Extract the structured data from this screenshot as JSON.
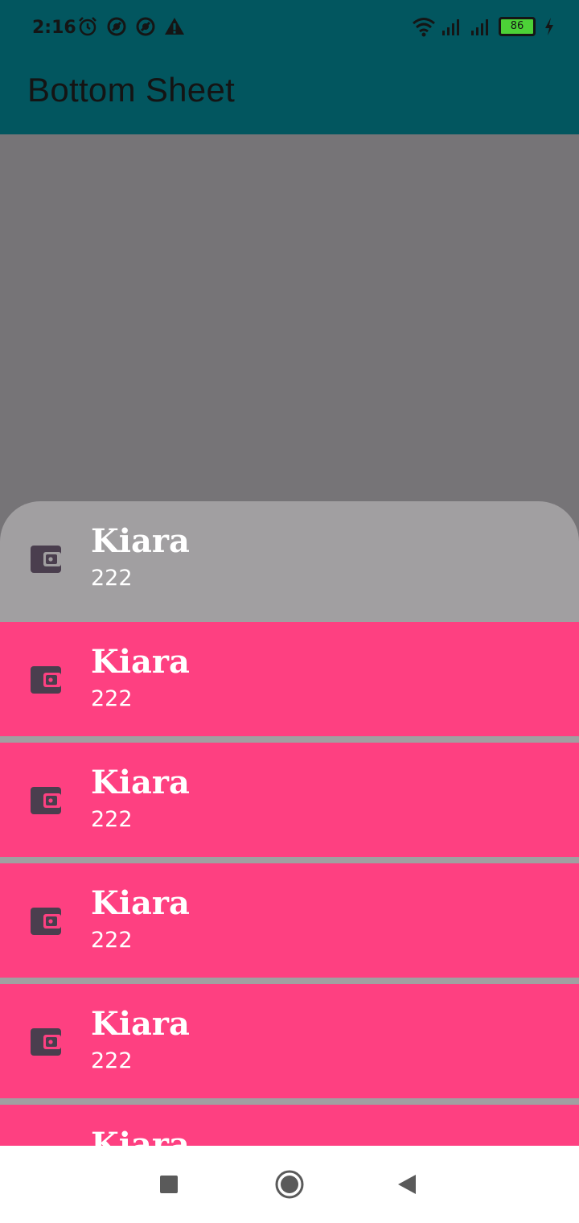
{
  "status_bar": {
    "time": "2:16",
    "battery_level": "86",
    "icons_left": [
      "alarm-icon",
      "data-saver-icon",
      "data-saver-icon",
      "warning-icon"
    ],
    "icons_right": [
      "wifi-icon",
      "signal-icon",
      "signal-icon",
      "battery-icon",
      "charging-icon"
    ]
  },
  "app_bar": {
    "title": "Bottom Sheet",
    "color": "#02565f"
  },
  "bottom_sheet": {
    "items": [
      {
        "title": "Kiara",
        "subtitle": "222",
        "icon": "wallet-icon",
        "selected": true
      },
      {
        "title": "Kiara",
        "subtitle": "222",
        "icon": "wallet-icon",
        "selected": false
      },
      {
        "title": "Kiara",
        "subtitle": "222",
        "icon": "wallet-icon",
        "selected": false
      },
      {
        "title": "Kiara",
        "subtitle": "222",
        "icon": "wallet-icon",
        "selected": false
      },
      {
        "title": "Kiara",
        "subtitle": "222",
        "icon": "wallet-icon",
        "selected": false
      },
      {
        "title": "Kiara",
        "subtitle": "",
        "icon": "wallet-icon",
        "selected": false
      }
    ],
    "item_color": "#fe4081",
    "selected_color": "#a19fa1"
  },
  "nav_bar": {
    "buttons": [
      "recents-icon",
      "home-icon",
      "back-icon"
    ]
  }
}
